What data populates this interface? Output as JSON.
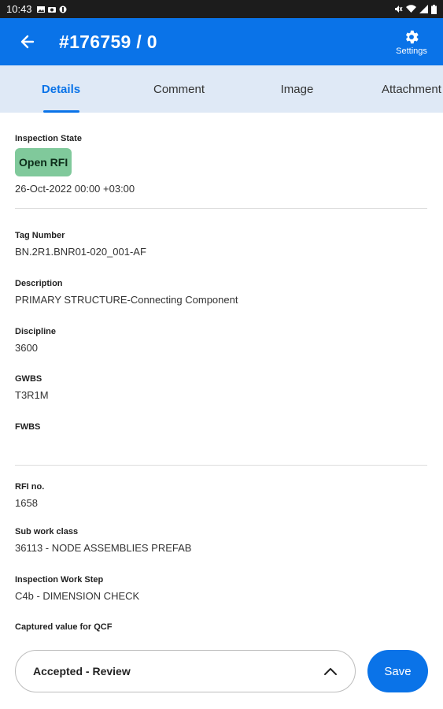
{
  "status_bar": {
    "time": "10:43",
    "icons": [
      "image-icon",
      "camera-icon",
      "circle-icon",
      "mute-icon",
      "wifi-icon",
      "signal-icon",
      "battery-icon"
    ]
  },
  "app_bar": {
    "title": "#176759 / 0",
    "settings_label": "Settings"
  },
  "tabs": [
    {
      "label": "Details",
      "active": true
    },
    {
      "label": "Comment",
      "active": false
    },
    {
      "label": "Image",
      "active": false
    },
    {
      "label": "Attachment",
      "active": false
    }
  ],
  "inspection": {
    "label": "Inspection State",
    "state": "Open RFI",
    "date": "26-Oct-2022 00:00  +03:00"
  },
  "fields": {
    "tag_number": {
      "label": "Tag Number",
      "value": "BN.2R1.BNR01-020_001-AF"
    },
    "description": {
      "label": "Description",
      "value": "PRIMARY STRUCTURE-Connecting Component"
    },
    "discipline": {
      "label": "Discipline",
      "value": "3600"
    },
    "gwbs": {
      "label": "GWBS",
      "value": "T3R1M"
    },
    "fwbs": {
      "label": "FWBS",
      "value": ""
    },
    "rfi_no": {
      "label": "RFI no.",
      "value": "1658"
    },
    "sub_work_class": {
      "label": "Sub work class",
      "value": "36113 - NODE ASSEMBLIES PREFAB"
    },
    "inspection_work_step": {
      "label": "Inspection Work Step",
      "value": "C4b - DIMENSION CHECK"
    },
    "captured_value": {
      "label": "Captured value for QCF",
      "value": ""
    }
  },
  "bottom": {
    "status_value": "Accepted - Review",
    "save_label": "Save"
  },
  "colors": {
    "primary": "#0a73e8",
    "tab_bg": "#dfe9f6",
    "badge": "#80c99b"
  }
}
